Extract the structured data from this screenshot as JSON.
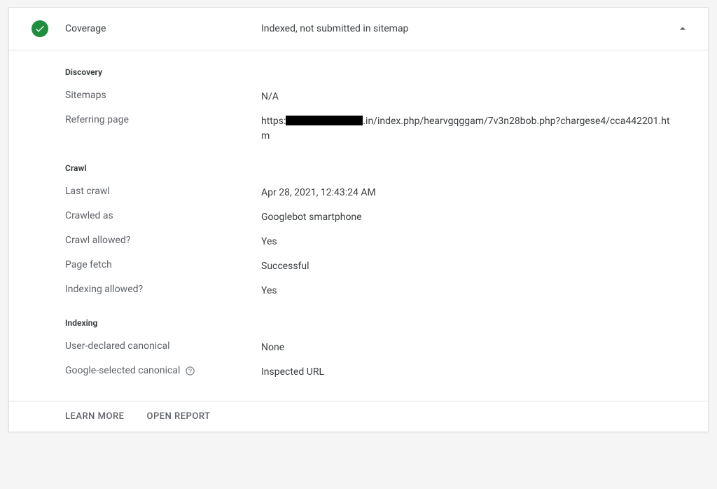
{
  "header": {
    "title": "Coverage",
    "status": "Indexed, not submitted in sitemap"
  },
  "sections": {
    "discovery": {
      "title": "Discovery",
      "sitemaps": {
        "label": "Sitemaps",
        "value": "N/A"
      },
      "referring": {
        "label": "Referring page",
        "prefix": "https:",
        "suffix": ".in/index.php/hearvgqggam/7v3n28bob.php?chargese4/cca442201.htm"
      }
    },
    "crawl": {
      "title": "Crawl",
      "last_crawl": {
        "label": "Last crawl",
        "value": "Apr 28, 2021, 12:43:24 AM"
      },
      "crawled_as": {
        "label": "Crawled as",
        "value": "Googlebot smartphone"
      },
      "crawl_allowed": {
        "label": "Crawl allowed?",
        "value": "Yes"
      },
      "page_fetch": {
        "label": "Page fetch",
        "value": "Successful"
      },
      "indexing_allowed": {
        "label": "Indexing allowed?",
        "value": "Yes"
      }
    },
    "indexing": {
      "title": "Indexing",
      "user_canonical": {
        "label": "User-declared canonical",
        "value": "None"
      },
      "google_canonical": {
        "label": "Google-selected canonical",
        "value": "Inspected URL"
      }
    }
  },
  "footer": {
    "learn_more": "LEARN MORE",
    "open_report": "OPEN REPORT"
  }
}
